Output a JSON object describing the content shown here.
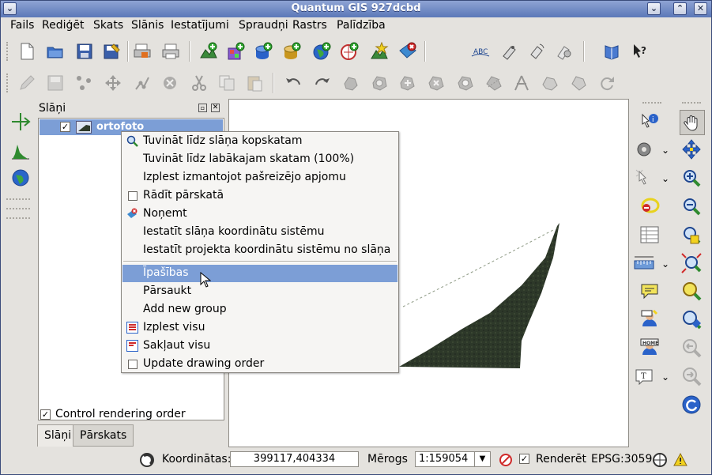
{
  "window": {
    "title": "Quantum GIS 927dcbd",
    "menu_glyph": "⌄",
    "min_glyph": "⌄",
    "max_glyph": "⌃",
    "close_glyph": "✕"
  },
  "menubar": [
    "Fails",
    "Rediģēt",
    "Skats",
    "Slānis",
    "Iestatījumi",
    "Spraudņi",
    "Rastrs",
    "Palīdzība"
  ],
  "dock": {
    "title": "Slāņi",
    "layer_name": "ortofoto",
    "control_label": "Control rendering order",
    "tabs": [
      "Slāņi",
      "Pārskats"
    ]
  },
  "context_menu": {
    "items": [
      {
        "label": "Tuvināt līdz slāņa kopskatam",
        "icon": "zoom-layer-icon"
      },
      {
        "label": "Tuvināt līdz labākajam skatam (100%)",
        "icon": ""
      },
      {
        "label": "Izplest izmantojot pašreizējo apjomu",
        "icon": ""
      },
      {
        "label": "Rādīt pārskatā",
        "icon": "checkbox"
      },
      {
        "label": "Noņemt",
        "icon": "remove-layer-icon"
      },
      {
        "label": "Iestatīt slāņa koordinātu sistēmu",
        "icon": ""
      },
      {
        "label": "Iestatīt projekta koordinātu sistēmu no slāņa",
        "icon": ""
      },
      {
        "label": "Īpašības",
        "icon": ""
      },
      {
        "label": "Pārsaukt",
        "icon": ""
      },
      {
        "label": "Add new group",
        "icon": ""
      },
      {
        "label": "Izplest visu",
        "icon": "expand-all-icon"
      },
      {
        "label": "Sakļaut visu",
        "icon": "collapse-all-icon"
      },
      {
        "label": "Update drawing order",
        "icon": "checkbox"
      }
    ],
    "selected": "Īpašības"
  },
  "status": {
    "coord_label": "Koordinātas:",
    "coord_value": "399117,404334",
    "scale_label": "Mērogs",
    "scale_value": "1:159054",
    "render_label": "Renderēt",
    "crs": "EPSG:3059"
  },
  "colors": {
    "selection": "#7c9ed6",
    "titlebar": "#6a84c2",
    "raster": "#2f3a2a"
  }
}
